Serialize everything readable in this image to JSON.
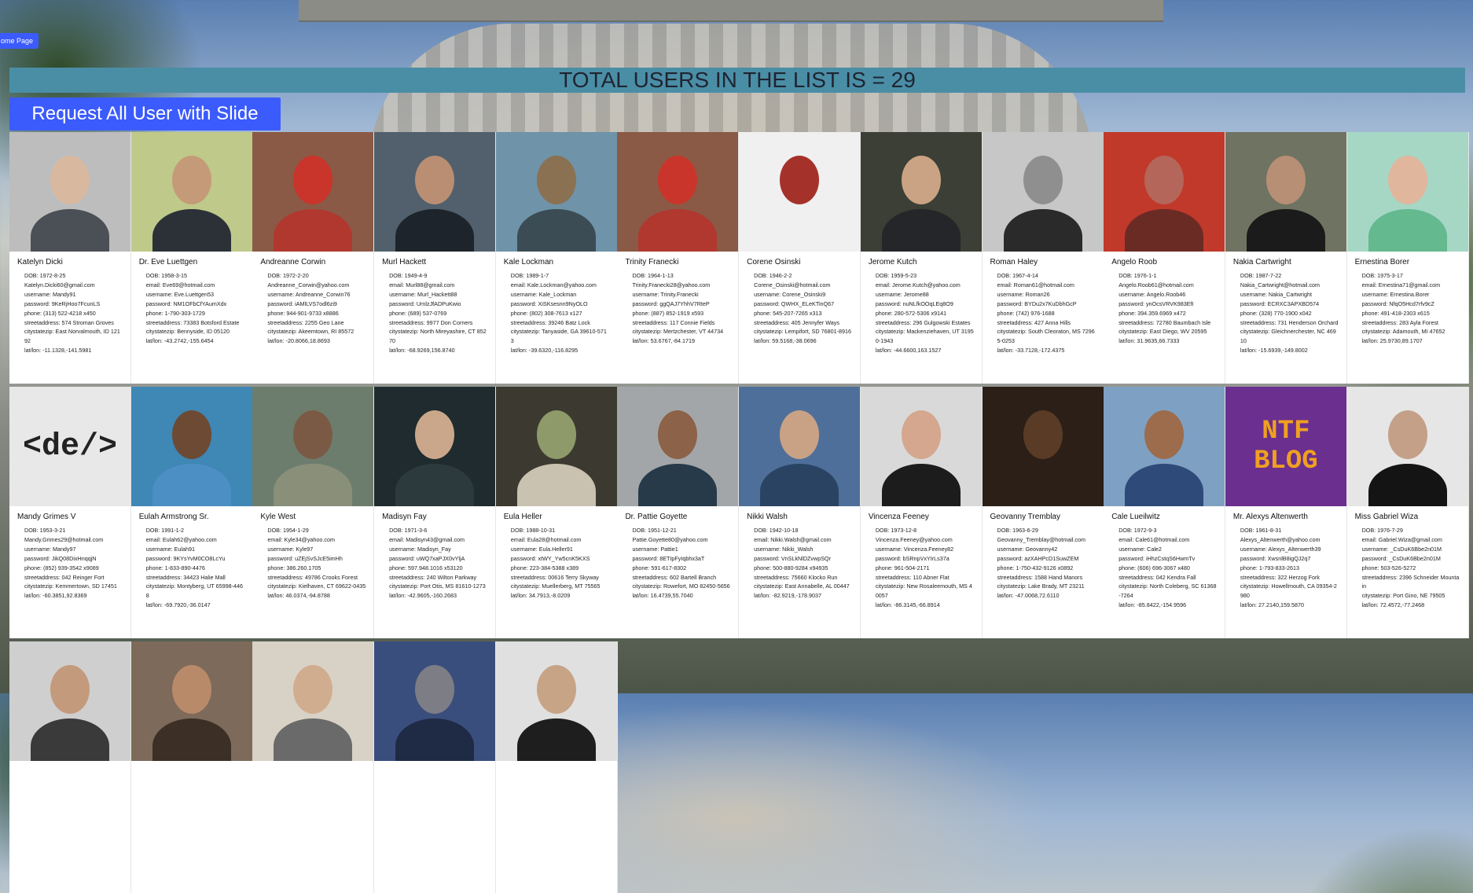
{
  "home_button": "ome Page",
  "banner": "TOTAL USERS IN THE LIST IS = 29",
  "slide_button": "Request All User with Slide show",
  "users": [
    {
      "name": "Katelyn Dicki",
      "dob": "DOB: 1972-8-25",
      "email": "Katelyn.Dicki60@gmail.com",
      "username": "username: Mandy91",
      "password": "password: 9KeRjHoo7FcunLS",
      "phone": "phone: (313) 522-4218 x450",
      "street": "streetaddress: 574 Stroman Groves",
      "city": "citystatezip: East Norvalmouth, ID 12192",
      "latlon": "lat/lon: -11.1328,-141.5981",
      "bg": "#bdbdbd",
      "skin": "#d8b9a0",
      "shirt": "#4b4f56"
    },
    {
      "name": "Dr. Eve Luettgen",
      "dob": "DOB: 1958-3-15",
      "email": "email: Eve69@hotmail.com",
      "username": "username: Eve.Luettgen53",
      "password": "password: NM1OFbCfYAumXdx",
      "phone": "phone: 1-790-303-1729",
      "street": "streetaddress: 73383 Botsford Estate",
      "city": "citystatezip: Bennyside, ID 05120",
      "latlon": "lat/lon: -43.2742,-155.6454",
      "bg": "#bfc98a",
      "skin": "#c59a78",
      "shirt": "#2c3138"
    },
    {
      "name": "Andreanne Corwin",
      "dob": "DOB: 1972-2-20",
      "email": "Andreanne_Corwin@yahoo.com",
      "username": "username: Andreanne_Corwin76",
      "password": "password: iAMlLVS7odl6zi9",
      "phone": "phone: 944-901-9733 x8886",
      "street": "streetaddress: 2255 Geo Lane",
      "city": "citystatezip: Akeemtown, RI 85572",
      "latlon": "lat/lon: -20.8066,18.8693",
      "bg": "#8a5a46",
      "skin": "#c9352b",
      "shirt": "#b0382e"
    },
    {
      "name": "Murl Hackett",
      "dob": "DOB: 1949-4-9",
      "email": "email: Murl88@gmail.com",
      "username": "username: Murl_Hackett88",
      "password": "password: UrnlzJfADPuKwio",
      "phone": "phone: (689) 537-0769",
      "street": "streetaddress: 9977 Don Corners",
      "city": "citystatezip: North Mireyashire, CT 85270",
      "latlon": "lat/lon: -68.9269,156.8740",
      "bg": "#51606c",
      "skin": "#b98e72",
      "shirt": "#1e242b"
    },
    {
      "name": "Kale Lockman",
      "dob": "DOB: 1989-1-7",
      "email": "email: Kale.Lockman@yahoo.com",
      "username": "username: Kale_Lockman",
      "password": "password: XiSKsesnn9NyOLO",
      "phone": "phone: (802) 308-7613 x127",
      "street": "streetaddress: 39246 Batz Lock",
      "city": "citystatezip: Tanyaside, GA 39610-5713",
      "latlon": "lat/lon: -39.6320,-116.8295",
      "bg": "#6f93a9",
      "skin": "#8a7152",
      "shirt": "#3c4c54"
    },
    {
      "name": "Trinity Franecki",
      "dob": "DOB: 1964-1-13",
      "email": "Trinity.Franecki28@yahoo.com",
      "username": "username: Trinity.Franecki",
      "password": "password: ggQAJ7YhhV7RteP",
      "phone": "phone: (887) 852-1919 x593",
      "street": "streetaddress: 117 Connie Fields",
      "city": "citystatezip: Mertzchester, VT 44734",
      "latlon": "lat/lon: 53.6767,-84.1719",
      "bg": "#8a5a46",
      "skin": "#c9352b",
      "shirt": "#b0382e"
    },
    {
      "name": "Corene Osinski",
      "dob": "DOB: 1946-2-2",
      "email": "Corene_Osinski@hotmail.com",
      "username": "username: Corene_Osinski9",
      "password": "password: QWHX_ELeKTinQ67",
      "phone": "phone: 545-207-7265 x313",
      "street": "streetaddress: 405 Jennyfer Ways",
      "city": "citystatezip: Lempifort, SD 76801-8916",
      "latlon": "lat/lon: 59.5168,-38.0696",
      "bg": "#f0f0f0",
      "skin": "#a5322a",
      "shirt": "#f0f0f0"
    },
    {
      "name": "Jerome Kutch",
      "dob": "DOB: 1959-5-23",
      "email": "email: Jerome.Kutch@yahoo.com",
      "username": "username: Jerome88",
      "password": "password: nuNLfkOOqLEq8O9",
      "phone": "phone: 280-572-5306 x9141",
      "street": "streetaddress: 296 Gulgowski Estates",
      "city": "citystatezip: Mackenziehaven, UT 31950-1943",
      "latlon": "lat/lon: -44.6600,163.1527",
      "bg": "#3c3f35",
      "skin": "#c9a383",
      "shirt": "#252629"
    },
    {
      "name": "Roman Haley",
      "dob": "DOB: 1967-4-14",
      "email": "email: Roman61@hotmail.com",
      "username": "username: Roman26",
      "password": "password: BYDu2x7KuDbhGcP",
      "phone": "phone: (742) 976-1688",
      "street": "streetaddress: 427 Anna Hills",
      "city": "citystatezip: South Cleoraton, MS 72965-0253",
      "latlon": "lat/lon: -33.7128,-172.4375",
      "bg": "#c7c7c7",
      "skin": "#8f8f8f",
      "shirt": "#2a2a2a"
    },
    {
      "name": "Angelo Roob",
      "dob": "DOB: 1976-1-1",
      "email": "Angelo.Roob61@hotmail.com",
      "username": "username: Angelo.Roob46",
      "password": "password: ynOcsVRVK983EfI",
      "phone": "phone: 394.359.6969 x472",
      "street": "streetaddress: 72780 Baumbach Isle",
      "city": "citystatezip: East Diego, WV 20595",
      "latlon": "lat/lon: 31.9635,66.7333",
      "bg": "#c0392b",
      "skin": "#b5665a",
      "shirt": "#6b2b25"
    },
    {
      "name": "Nakia Cartwright",
      "dob": "DOB: 1987-7-22",
      "email": "Nakia_Cartwright@hotmail.com",
      "username": "username: Nakia_Cartwright",
      "password": "password: ECRXC3APXBD574",
      "phone": "phone: (328) 770-1900 x042",
      "street": "streetaddress: 731 Henderson Orchard",
      "city": "citystatezip: Gleichnerchester, NC 46910",
      "latlon": "lat/lon: -15.6939,-149.8002",
      "bg": "#6f7361",
      "skin": "#b78f74",
      "shirt": "#1b1b1b"
    },
    {
      "name": "Ernestina Borer",
      "dob": "DOB: 1975-3-17",
      "email": "email: Ernestina71@gmail.com",
      "username": "username: Ernestina.Borer",
      "password": "password: NfqO5Hcd7rfv9cZ",
      "phone": "phone: 491-418-2303 x615",
      "street": "streetaddress: 283 Ayla Forest",
      "city": "citystatezip: Adamouth, MI 47652",
      "latlon": "lat/lon: 25.9730,89.1707",
      "bg": "#a6d7c4",
      "skin": "#e0b69d",
      "shirt": "#64b98f"
    },
    {
      "name": "Mandy Grimes V",
      "dob": "DOB: 1953-3-21",
      "email": "Mandy.Grimes29@hotmail.com",
      "username": "username: Mandy97",
      "password": "password: JikQ08DixHnqqjN",
      "phone": "phone: (852) 939-3542 x9089",
      "street": "streetaddress: 042 Reinger Fort",
      "city": "citystatezip: Kemmertown, SD 17451",
      "latlon": "lat/lon: -60.3851,92.8369",
      "bg": "#e8e8e8",
      "skin": "",
      "shirt": "",
      "badge": "<de/>"
    },
    {
      "name": "Eulah Armstrong Sr.",
      "dob": "DOB: 1991-1-2",
      "email": "email: Eulah62@yahoo.com",
      "username": "username: Eulah91",
      "password": "password: 9KYsYvM0CO8LcYu",
      "phone": "phone: 1-833-890-4476",
      "street": "streetaddress: 34423 Halie Mall",
      "city": "citystatezip: Montyberg, UT 65998-4468",
      "latlon": "lat/lon: -69.7920,-36.0147",
      "bg": "#3f87b5",
      "skin": "#6d4a33",
      "shirt": "#4c8fc4"
    },
    {
      "name": "Kyle West",
      "dob": "DOB: 1954-1-29",
      "email": "email: Kyle34@yahoo.com",
      "username": "username: Kyle97",
      "password": "password: uZEjSvSJcE5imHh",
      "phone": "phone: 386.260.1705",
      "street": "streetaddress: 49786 Crooks Forest",
      "city": "citystatezip: Kielhaven, CT 69622-0435",
      "latlon": "lat/lon: 46.0374,-94.8788",
      "bg": "#6d7d6d",
      "skin": "#7b5a45",
      "shirt": "#8a8f7a"
    },
    {
      "name": "Madisyn Fay",
      "dob": "DOB: 1971-3-6",
      "email": "email: Madisyn43@gmail.com",
      "username": "username: Madisyn_Fay",
      "password": "password: uWQ7xaPJX0vYljA",
      "phone": "phone: 597.948.1016 x53120",
      "street": "streetaddress: 240 Wilton Parkway",
      "city": "citystatezip: Port Otis, MS 81610-1273",
      "latlon": "lat/lon: -42.9605,-160.2683",
      "bg": "#1f2b2e",
      "skin": "#caa78a",
      "shirt": "#2c3a3d"
    },
    {
      "name": "Eula Heller",
      "dob": "DOB: 1988-10-31",
      "email": "email: Eula28@hotmail.com",
      "username": "username: Eula.Heller91",
      "password": "password: xtWY_Yw5cnK5KXS",
      "phone": "phone: 223-384-5388 x389",
      "street": "streetaddress: 00616 Terry Skyway",
      "city": "citystatezip: Muellerberg, MT 75565",
      "latlon": "lat/lon: 34.7913,-8.0209",
      "bg": "#3c3a30",
      "skin": "#8e9a6a",
      "shirt": "#c9c2b0"
    },
    {
      "name": "Dr. Pattie Goyette",
      "dob": "DOB: 1951-12-21",
      "email": "Pattie.Goyette80@yahoo.com",
      "username": "username: Pattie1",
      "password": "password: 8ETIpFyIqbhx3aT",
      "phone": "phone: 591-617-8302",
      "street": "streetaddress: 602 Bartell Branch",
      "city": "citystatezip: Rowefort, MO 82450-5656",
      "latlon": "lat/lon: 16.4739,55.7040",
      "bg": "#a3a6a8",
      "skin": "#8c6248",
      "shirt": "#263a4a"
    },
    {
      "name": "Nikki Walsh",
      "dob": "DOB: 1942-10-18",
      "email": "email: Nikki.Walsh@gmail.com",
      "username": "username: Nikki_Walsh",
      "password": "password: VnSLkNlDZvwpSQr",
      "phone": "phone: 500-880-9284 x94935",
      "street": "streetaddress: 75660 Klocko Run",
      "city": "citystatezip: East Annabelle, AL 00447",
      "latlon": "lat/lon: -82.9219,-178.9037",
      "bg": "#4e6f9a",
      "skin": "#c9a286",
      "shirt": "#2a4363"
    },
    {
      "name": "Vincenza Feeney",
      "dob": "DOB: 1973-12-8",
      "email": "Vincenza.Feeney@yahoo.com",
      "username": "username: Vincenza.Feeney82",
      "password": "password: bSRnpVxYIrLs37a",
      "phone": "phone: 961-504-2171",
      "street": "streetaddress: 110 Abner Flat",
      "city": "citystatezip: New Rosaleemouth, MS 40057",
      "latlon": "lat/lon: -86.3145,-66.8914",
      "bg": "#d9d9d9",
      "skin": "#d4a78e",
      "shirt": "#1c1c1c"
    },
    {
      "name": "Geovanny Tremblay",
      "dob": "DOB: 1963-6-29",
      "email": "Geovanny_Tremblay@hotmail.com",
      "username": "username: Geovanny42",
      "password": "password: azXAHPcD1SuwZEM",
      "phone": "phone: 1-750-432-9126 x0892",
      "street": "streetaddress: 1588 Hand Manors",
      "city": "citystatezip: Lake Brady, MT 23211",
      "latlon": "lat/lon: -47.0068,72.6110",
      "bg": "#2b1f18",
      "skin": "#5a3b25",
      "shirt": "#2b1f18"
    },
    {
      "name": "Cale Lueilwitz",
      "dob": "DOB: 1972-9-3",
      "email": "email: Cale61@hotmail.com",
      "username": "username: Cale2",
      "password": "password: iHhzCstqS6HwmTv",
      "phone": "phone: (606) 696-3067 x480",
      "street": "streetaddress: 042 Kendra Fall",
      "city": "citystatezip: North Coleberg, SC 61368-7264",
      "latlon": "lat/lon: -85.8422,-154.9596",
      "bg": "#7ea0c2",
      "skin": "#9c6c4c",
      "shirt": "#2d4a79"
    },
    {
      "name": "Mr. Alexys Altenwerth",
      "dob": "DOB: 1961-8-31",
      "email": "Alexys_Altenwerth@yahoo.com",
      "username": "username: Alexys_Altenwerth39",
      "password": "password: XwsnlB8igQJ2q7",
      "phone": "phone: 1-793-833-2613",
      "street": "streetaddress: 322 Herzog Fork",
      "city": "citystatezip: Howellmouth, CA 09354-2980",
      "latlon": "lat/lon: 27.2140,159.5870",
      "bg": "#6a2f8f",
      "skin": "",
      "shirt": "",
      "badge": "NTF BLOG"
    },
    {
      "name": "Miss Gabriel Wiza",
      "dob": "DOB: 1976-7-29",
      "email": "email: Gabriel.Wiza@gmail.com",
      "username": "username: _CsDuK6Bbe2n01M",
      "password": "password: _CsDuK6Bbe2n01M",
      "phone": "phone: 503-526-5272",
      "street": "streetaddress: 2396 Schneider Mountain",
      "city": "citystatezip: Port Gino, NE 79505",
      "latlon": "lat/lon: 72.4572,-77.2468",
      "bg": "#e6e6e6",
      "skin": "#c4a089",
      "shirt": "#141414"
    },
    {
      "name": "",
      "dob": "",
      "email": "",
      "username": "",
      "password": "",
      "phone": "",
      "street": "",
      "city": "",
      "latlon": "",
      "bg": "#cfcfcf",
      "skin": "#c49a7c",
      "shirt": "#3a3a3a"
    },
    {
      "name": "",
      "dob": "",
      "email": "",
      "username": "",
      "password": "",
      "phone": "",
      "street": "",
      "city": "",
      "latlon": "",
      "bg": "#7d6a5a",
      "skin": "#b88a6a",
      "shirt": "#3c2f25"
    },
    {
      "name": "",
      "dob": "",
      "email": "",
      "username": "",
      "password": "",
      "phone": "",
      "street": "",
      "city": "",
      "latlon": "",
      "bg": "#d8d2c6",
      "skin": "#d1ad8f",
      "shirt": "#6a6a6a"
    },
    {
      "name": "",
      "dob": "",
      "email": "",
      "username": "",
      "password": "",
      "phone": "",
      "street": "",
      "city": "",
      "latlon": "",
      "bg": "#3a4e7d",
      "skin": "#7d7d85",
      "shirt": "#1f2a44"
    },
    {
      "name": "",
      "dob": "",
      "email": "",
      "username": "",
      "password": "",
      "phone": "",
      "street": "",
      "city": "",
      "latlon": "",
      "bg": "#e0e0e0",
      "skin": "#c8a487",
      "shirt": "#1e1e1e"
    }
  ]
}
